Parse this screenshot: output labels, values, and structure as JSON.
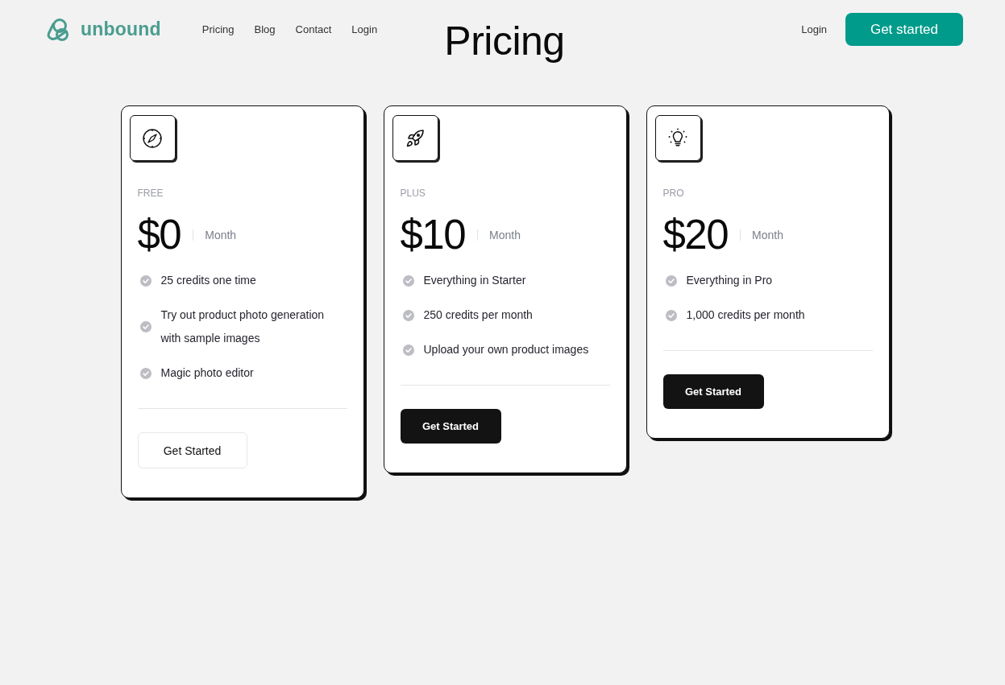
{
  "header": {
    "logo": {
      "text": "unbound"
    },
    "nav": [
      "Pricing",
      "Blog",
      "Contact",
      "Login"
    ],
    "title": "Pricing",
    "login": "Login",
    "cta": "Get started"
  },
  "plans": [
    {
      "name": "FREE",
      "price": "$0",
      "period": "Month",
      "features": [
        "25 credits one time",
        "Try out product photo generation with sample images",
        "Magic photo editor"
      ],
      "button": {
        "label": "Get Started",
        "kind": "outline"
      }
    },
    {
      "name": "PLUS",
      "price": "$10",
      "period": "Month",
      "features": [
        "Everything in Starter",
        "250 credits per month",
        "Upload your own product images"
      ],
      "button": {
        "label": "Get Started",
        "kind": "solid"
      }
    },
    {
      "name": "PRO",
      "price": "$20",
      "period": "Month",
      "features": [
        "Everything in Pro",
        "1,000 credits per month"
      ],
      "button": {
        "label": "Get Started",
        "kind": "solid"
      }
    }
  ]
}
